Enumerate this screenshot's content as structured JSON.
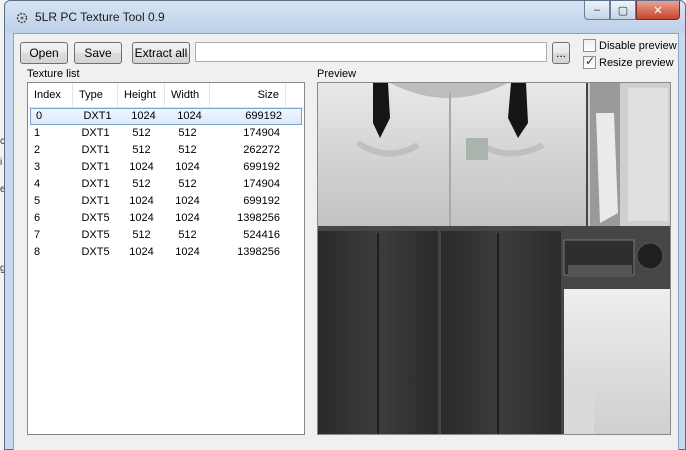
{
  "window": {
    "title": "5LR PC Texture Tool 0.9",
    "caption_minimize": "–",
    "caption_maximize": "▢",
    "caption_close": "✕"
  },
  "toolbar": {
    "open_label": "Open",
    "save_label": "Save",
    "extract_all_label": "Extract all",
    "path_value": "",
    "browse_label": "..."
  },
  "options": {
    "disable_preview_label": "Disable preview",
    "disable_preview_checked": false,
    "resize_preview_label": "Resize preview",
    "resize_preview_checked": true
  },
  "texture_list": {
    "label": "Texture list",
    "columns": [
      "Index",
      "Type",
      "Height",
      "Width",
      "Size"
    ],
    "selected_index": 0,
    "rows": [
      {
        "index": "0",
        "type": "DXT1",
        "height": "1024",
        "width": "1024",
        "size": "699192"
      },
      {
        "index": "1",
        "type": "DXT1",
        "height": "512",
        "width": "512",
        "size": "174904"
      },
      {
        "index": "2",
        "type": "DXT1",
        "height": "512",
        "width": "512",
        "size": "262272"
      },
      {
        "index": "3",
        "type": "DXT1",
        "height": "1024",
        "width": "1024",
        "size": "699192"
      },
      {
        "index": "4",
        "type": "DXT1",
        "height": "512",
        "width": "512",
        "size": "174904"
      },
      {
        "index": "5",
        "type": "DXT1",
        "height": "1024",
        "width": "1024",
        "size": "699192"
      },
      {
        "index": "6",
        "type": "DXT5",
        "height": "1024",
        "width": "1024",
        "size": "1398256"
      },
      {
        "index": "7",
        "type": "DXT5",
        "height": "512",
        "width": "512",
        "size": "524416"
      },
      {
        "index": "8",
        "type": "DXT5",
        "height": "1024",
        "width": "1024",
        "size": "1398256"
      }
    ]
  },
  "preview": {
    "label": "Preview"
  },
  "icons": {
    "app": "app-gear-icon",
    "minimize": "minimize-icon",
    "maximize": "maximize-icon",
    "close": "close-icon",
    "check": "checkmark-icon"
  }
}
